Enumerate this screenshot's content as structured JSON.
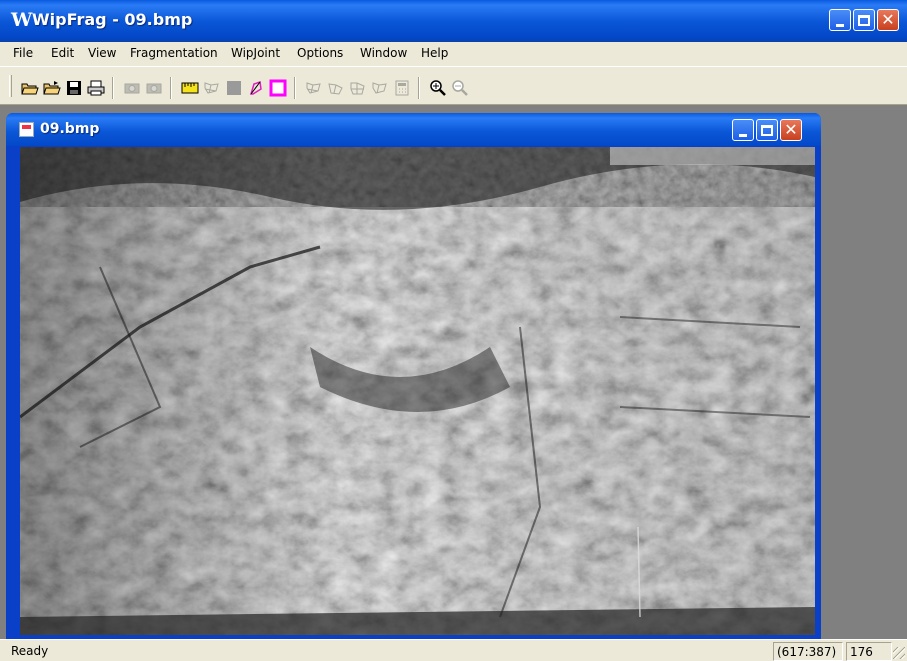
{
  "app": {
    "title": "WipFrag - 09.bmp",
    "icon_letter": "W"
  },
  "window_controls": {
    "minimize_icon": "minimize-icon",
    "maximize_icon": "maximize-icon",
    "close_icon": "close-icon",
    "close_glyph": "✕"
  },
  "menu": {
    "items": [
      {
        "label": "File"
      },
      {
        "label": "Edit"
      },
      {
        "label": "View"
      },
      {
        "label": "Fragmentation"
      },
      {
        "label": "WipJoint"
      },
      {
        "label": "Options"
      },
      {
        "label": "Window"
      },
      {
        "label": "Help"
      }
    ]
  },
  "toolbar": {
    "buttons": [
      {
        "icon": "open-folder-icon"
      },
      {
        "icon": "open-folder-alt-icon"
      },
      {
        "icon": "save-disk-icon"
      },
      {
        "icon": "print-icon"
      },
      {
        "icon": "camera-icon",
        "disabled": true
      },
      {
        "icon": "camera-alt-icon",
        "disabled": true
      },
      {
        "icon": "scale-ruler-icon"
      },
      {
        "icon": "net-grid-icon",
        "disabled": true
      },
      {
        "icon": "gray-square-icon"
      },
      {
        "icon": "polygon-edit-icon"
      },
      {
        "icon": "magenta-square-icon"
      },
      {
        "icon": "network-one-icon",
        "disabled": true
      },
      {
        "icon": "network-two-icon",
        "disabled": true
      },
      {
        "icon": "network-three-icon",
        "disabled": true
      },
      {
        "icon": "network-four-icon",
        "disabled": true
      },
      {
        "icon": "calculator-icon",
        "disabled": true
      },
      {
        "icon": "zoom-in-icon"
      },
      {
        "icon": "zoom-out-icon",
        "disabled": true
      }
    ],
    "colors": {
      "yellow": "#f4e21a",
      "magenta": "#ff00ff",
      "gray": "#9a9a9a",
      "disabled": "#a8a8a0"
    }
  },
  "child_window": {
    "title": "09.bmp",
    "image_description_icon": "rock-face-photo"
  },
  "statusbar": {
    "text": "Ready",
    "coords": "(617:387)",
    "value": "176"
  },
  "colors": {
    "titlebar_blue": "#0b58d8",
    "close_red": "#d9552f",
    "chrome": "#ece9d8",
    "mdi_background": "#808080"
  }
}
